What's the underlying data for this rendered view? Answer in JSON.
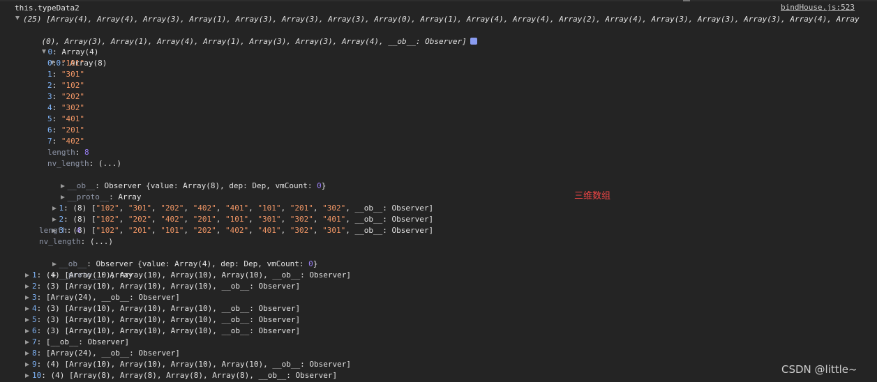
{
  "console": {
    "label": "this.typeData2",
    "source_link": "bindHouse.js:523",
    "summary_line1": "(25) [Array(4), Array(4), Array(3), Array(1), Array(3), Array(3), Array(3), Array(0), Array(1), Array(4), Array(4), Array(2), Array(4), Array(3), Array(3), Array(3), Array(4), Array",
    "summary_line2": "(0), Array(3), Array(1), Array(4), Array(1), Array(3), Array(3), Array(4), __ob__: Observer]",
    "item0_key": "0",
    "item0_type": "Array(4)",
    "sub0_key": "0",
    "sub0_type": "Array(8)",
    "sub0_items": [
      {
        "k": "0",
        "v": "\"101\""
      },
      {
        "k": "1",
        "v": "\"301\""
      },
      {
        "k": "2",
        "v": "\"102\""
      },
      {
        "k": "3",
        "v": "\"202\""
      },
      {
        "k": "4",
        "v": "\"302\""
      },
      {
        "k": "5",
        "v": "\"401\""
      },
      {
        "k": "6",
        "v": "\"201\""
      },
      {
        "k": "7",
        "v": "\"402\""
      }
    ],
    "sub0_length_key": "length",
    "sub0_length_val": "8",
    "sub0_nvlength_key": "nv_length",
    "sub0_nvlength_val": "(...)",
    "sub0_ob_key": "__ob__",
    "sub0_ob_prefix": "Observer {value: Array(8), dep: Dep, vmCount: ",
    "sub0_ob_count": "0",
    "sub0_ob_suffix": "}",
    "sub0_proto_key": "__proto__",
    "sub0_proto_val": "Array",
    "sub_rows": [
      {
        "k": "1",
        "count": "(8) [",
        "items": [
          "\"102\"",
          "\"301\"",
          "\"202\"",
          "\"402\"",
          "\"401\"",
          "\"101\"",
          "\"201\"",
          "\"302\""
        ],
        "tail": "__ob__: Observer]"
      },
      {
        "k": "2",
        "count": "(8) [",
        "items": [
          "\"102\"",
          "\"202\"",
          "\"402\"",
          "\"201\"",
          "\"101\"",
          "\"301\"",
          "\"302\"",
          "\"401\""
        ],
        "tail": "__ob__: Observer]"
      },
      {
        "k": "3",
        "count": "(8) [",
        "items": [
          "\"102\"",
          "\"201\"",
          "\"101\"",
          "\"202\"",
          "\"402\"",
          "\"401\"",
          "\"302\"",
          "\"301\""
        ],
        "tail": "__ob__: Observer]"
      }
    ],
    "item0_length_key": "length",
    "item0_length_val": "4",
    "item0_nvlength_key": "nv_length",
    "item0_nvlength_val": "(...)",
    "item0_ob_key": "__ob__",
    "item0_ob_prefix": "Observer {value: Array(4), dep: Dep, vmCount: ",
    "item0_ob_count": "0",
    "item0_ob_suffix": "}",
    "item0_proto_key": "__proto__",
    "item0_proto_val": "Array",
    "top_rows": [
      {
        "k": "1",
        "v": "(4) [Array(10), Array(10), Array(10), Array(10), __ob__: Observer]"
      },
      {
        "k": "2",
        "v": "(3) [Array(10), Array(10), Array(10), __ob__: Observer]"
      },
      {
        "k": "3",
        "v": "[Array(24), __ob__: Observer]"
      },
      {
        "k": "4",
        "v": "(3) [Array(10), Array(10), Array(10), __ob__: Observer]"
      },
      {
        "k": "5",
        "v": "(3) [Array(10), Array(10), Array(10), __ob__: Observer]"
      },
      {
        "k": "6",
        "v": "(3) [Array(10), Array(10), Array(10), __ob__: Observer]"
      },
      {
        "k": "7",
        "v": "[__ob__: Observer]"
      },
      {
        "k": "8",
        "v": "[Array(24), __ob__: Observer]"
      },
      {
        "k": "9",
        "v": "(4) [Array(10), Array(10), Array(10), Array(10), __ob__: Observer]"
      },
      {
        "k": "10",
        "v": "(4) [Array(8), Array(8), Array(8), Array(8), __ob__: Observer]"
      }
    ]
  },
  "annotation": "三维数组",
  "watermark": "CSDN @little~",
  "colors": {
    "background": "#242424",
    "key": "#7fb4f8",
    "string": "#f29766",
    "number": "#9a7ff5",
    "annotation": "#f04646"
  },
  "icons": [
    "expand-triangle-icon",
    "collapse-triangle-icon",
    "info-icon"
  ]
}
